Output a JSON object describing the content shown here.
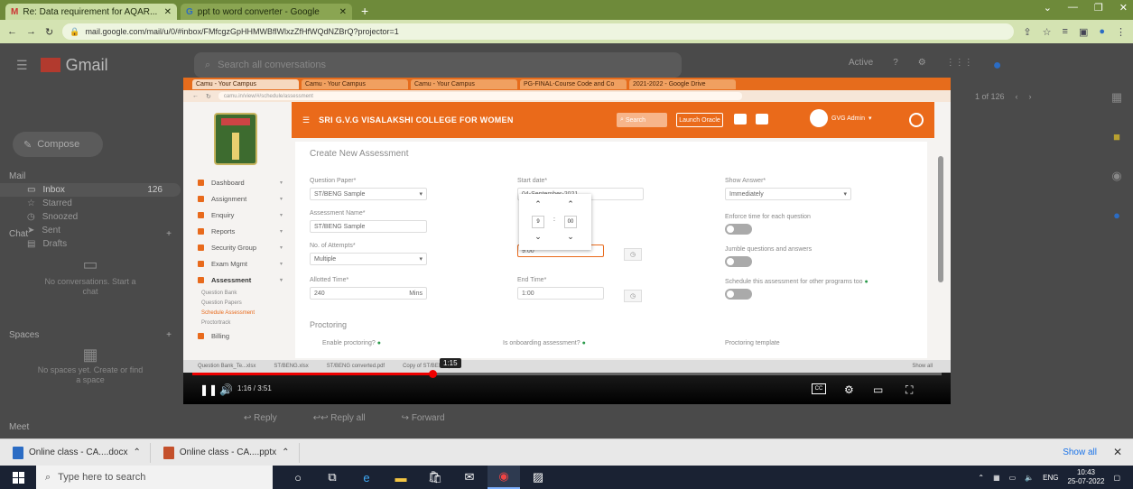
{
  "browser": {
    "tabs": [
      {
        "label": "Re: Data requirement for AQAR...",
        "active": true
      },
      {
        "label": "ppt to word converter - Google",
        "active": false
      }
    ],
    "url": "mail.google.com/mail/u/0/#inbox/FMfcgzGpHHMWBflWlxzZfHfWQdNZBrQ?projector=1"
  },
  "gmail": {
    "app_name": "Gmail",
    "search_placeholder": "Search all conversations",
    "compose_label": "Compose",
    "mail_header": "Mail",
    "folders": [
      {
        "label": "Inbox",
        "count": "126",
        "selected": true
      },
      {
        "label": "Starred",
        "count": ""
      },
      {
        "label": "Snoozed",
        "count": ""
      },
      {
        "label": "Sent",
        "count": ""
      },
      {
        "label": "Drafts",
        "count": ""
      }
    ],
    "chat_header": "Chat",
    "chat_empty": "No conversations. Start a chat",
    "spaces_header": "Spaces",
    "spaces_empty": "No spaces yet. Create or find a space",
    "meet_header": "Meet",
    "pager": "1 of 126",
    "footer_actions": [
      "Reply",
      "Reply all",
      "Forward"
    ],
    "status": "Active"
  },
  "video": {
    "inner_tabs": [
      "Camu - Your Campus",
      "Camu - Your Campus",
      "Camu - Your Campus",
      "PG-FINAL-Course Code and Co",
      "2021-2022 - Google Drive"
    ],
    "inner_url": "camu.in/view/#/schedule/assessment",
    "college_name": "SRI G.V.G VISALAKSHI COLLEGE FOR WOMEN",
    "search_label": "Search",
    "launch_label": "Launch Oracle",
    "admin_name": "GVG Admin",
    "nav": [
      {
        "label": "Dashboard"
      },
      {
        "label": "Assignment"
      },
      {
        "label": "Enquiry"
      },
      {
        "label": "Reports"
      },
      {
        "label": "Security Group"
      },
      {
        "label": "Exam Mgmt"
      },
      {
        "label": "Assessment"
      }
    ],
    "nav_sub": [
      "Question Bank",
      "Question Papers",
      "Schedule Assessment",
      "Proctortrack"
    ],
    "nav_last": "Billing",
    "page_title": "Create New Assessment",
    "fields": {
      "question_paper_label": "Question Paper*",
      "question_paper_value": "ST/BENG Sample",
      "assessment_name_label": "Assessment Name*",
      "assessment_name_value": "ST/BENG Sample",
      "attempts_label": "No. of Attempts*",
      "attempts_value": "Multiple",
      "allotted_label": "Allotted Time*",
      "allotted_value": "240",
      "allotted_unit": "Mins",
      "start_date_label": "Start date*",
      "start_date_value": "04-September-2021",
      "start_time_value": "9:00",
      "end_time_label": "End Time*",
      "end_time_value": "1:00",
      "show_answer_label": "Show Answer*",
      "show_answer_value": "Immediately",
      "enforce_label": "Enforce time for each question",
      "jumble_label": "Jumble questions and answers",
      "schedule_label": "Schedule this assessment for other programs too",
      "toggle_off": "NO"
    },
    "picker": {
      "hour": "9",
      "minute": "00"
    },
    "proctoring_title": "Proctoring",
    "proctoring": {
      "enable_label": "Enable proctoring?",
      "onboarding_label": "Is onboarding assessment?",
      "template_label": "Proctoring template"
    },
    "downloads": [
      "Question Bank_Te...xlsx",
      "ST/BENG.xlsx",
      "ST/BENG converted.pdf",
      "Copy of ST/BENG.pdf"
    ],
    "show_all": "Show all",
    "bubble_time": "1:15",
    "time_display": "1:16 / 3:51",
    "progress": 0.32,
    "cc_label": "CC"
  },
  "downloads": [
    {
      "label": "Online class - CA....docx"
    },
    {
      "label": "Online class - CA....pptx"
    }
  ],
  "downloads_show_all": "Show all",
  "taskbar": {
    "search_placeholder": "Type here to search",
    "lang": "ENG",
    "time": "10:43",
    "date": "25-07-2022"
  }
}
